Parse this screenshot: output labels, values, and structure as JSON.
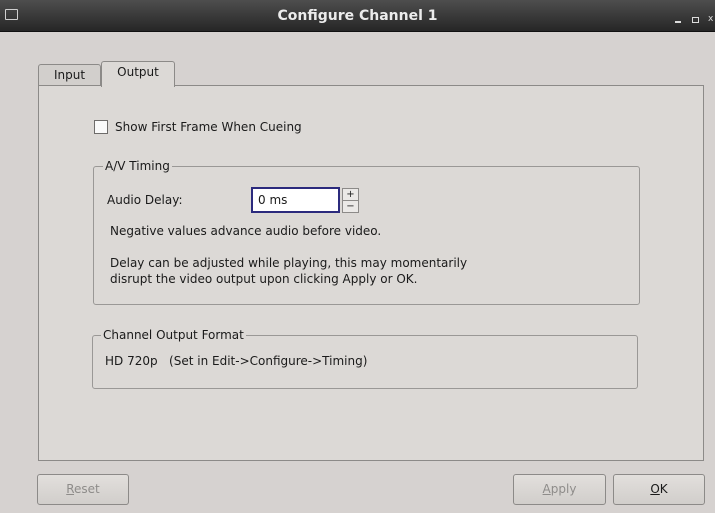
{
  "window": {
    "title": "Configure Channel 1",
    "icon": "window-icon",
    "minimize_glyph": "_",
    "close_glyph": "x"
  },
  "tabs": [
    {
      "label": "Input",
      "selected": false
    },
    {
      "label": "Output",
      "selected": true
    }
  ],
  "output": {
    "show_first_frame": {
      "label": "Show First Frame When Cueing",
      "checked": false
    },
    "av_timing": {
      "legend": "A/V Timing",
      "audio_delay_label": "Audio Delay:",
      "audio_delay_value": "0 ms",
      "spin_up": "+",
      "spin_down": "−",
      "note1": "Negative values advance audio before video.",
      "note2_line1": "Delay can be adjusted while playing, this may momentarily",
      "note2_line2": "disrupt the video output upon clicking Apply or OK."
    },
    "channel_output_format": {
      "legend": "Channel Output Format",
      "value": "HD 720p   (Set in Edit->Configure->Timing)"
    }
  },
  "buttons": {
    "reset": {
      "mnemonic": "R",
      "rest": "eset",
      "enabled": false
    },
    "apply": {
      "mnemonic": "A",
      "rest": "pply",
      "enabled": false
    },
    "ok": {
      "mnemonic": "O",
      "rest": "K",
      "enabled": true
    }
  },
  "colors": {
    "background": "#d6d2d0",
    "titlebar": "#2f2f2f",
    "focus_border": "#2b2a7d"
  }
}
